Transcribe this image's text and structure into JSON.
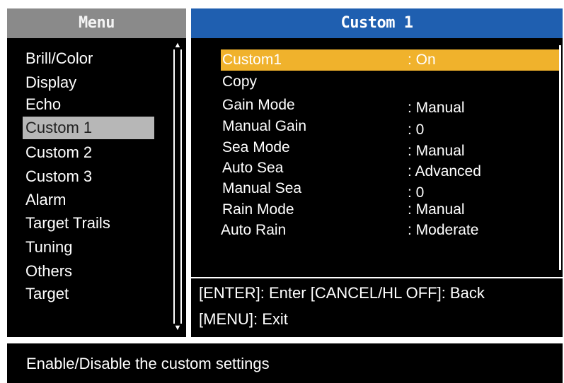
{
  "menu": {
    "title": "Menu",
    "items": [
      "Brill/Color",
      "Display",
      "Echo",
      "Custom 1",
      "Custom 2",
      "Custom 3",
      "Alarm",
      "Target Trails",
      "Tuning",
      "Others",
      "Target"
    ],
    "selected_index": 3
  },
  "custom": {
    "title": "Custom 1",
    "rows": [
      {
        "label": "Custom1",
        "value": ": On"
      },
      {
        "label": "Copy",
        "value": ""
      },
      {
        "label": "Gain Mode",
        "value": ": Manual"
      },
      {
        "label": "Manual Gain",
        "value": ": 0"
      },
      {
        "label": "Sea Mode",
        "value": ": Manual"
      },
      {
        "label": "Auto Sea",
        "value": ": Advanced"
      },
      {
        "label": "Manual Sea",
        "value": ": 0"
      },
      {
        "label": "Rain Mode",
        "value": ": Manual"
      },
      {
        "label": "Auto Rain",
        "value": ": Moderate"
      }
    ],
    "highlighted_index": 0
  },
  "key_help": {
    "line1": "[ENTER]: Enter [CANCEL/HL OFF]: Back",
    "line2": "[MENU]: Exit"
  },
  "help_text": "Enable/Disable the custom settings",
  "colors": {
    "menu_title_bg": "#8a8a8a",
    "custom_title_bg": "#1f5fb0",
    "highlight": "#f0b22c",
    "selected_menu": "#b7b7b7"
  }
}
